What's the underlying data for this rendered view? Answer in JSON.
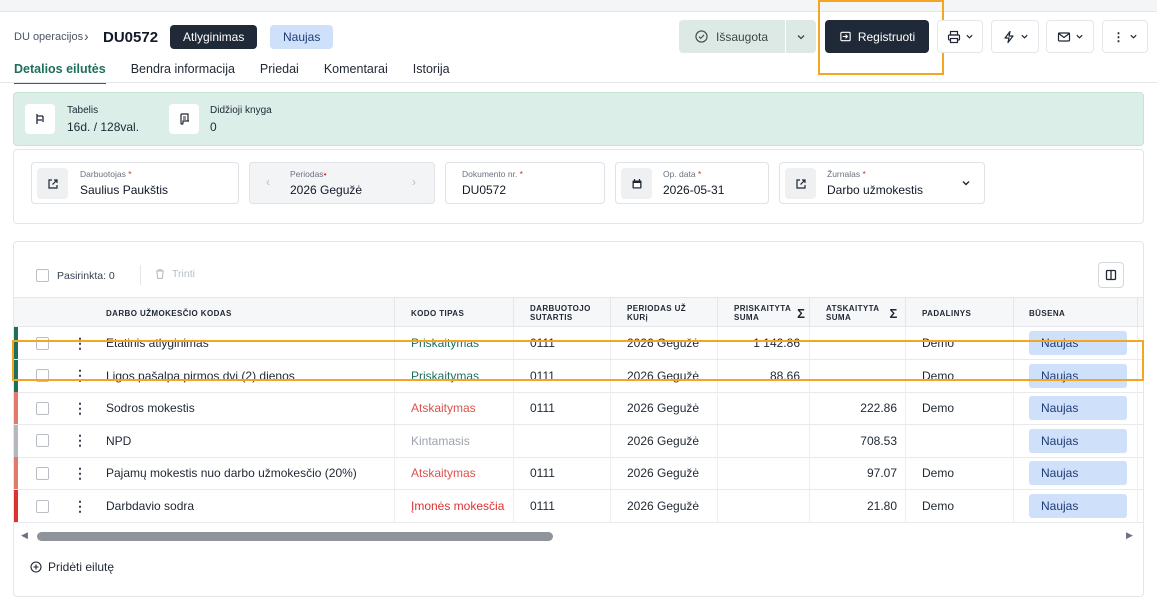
{
  "header": {
    "breadcrumb": "DU operacijos",
    "doc_id": "DU0572",
    "type_badge": "Atlyginimas",
    "status_badge": "Naujas",
    "saved_label": "Išsaugota",
    "register_label": "Registruoti"
  },
  "tabs": [
    "Detalios eilutės",
    "Bendra informacija",
    "Priedai",
    "Komentarai",
    "Istorija"
  ],
  "summary": {
    "tabelis_label": "Tabelis",
    "tabelis_value": "16d. / 128val.",
    "ledger_label": "Didžioji knyga",
    "ledger_value": "0"
  },
  "form": {
    "employee_label": "Darbuotojas",
    "employee_value": "Saulius Paukštis",
    "period_label": "Periodas",
    "period_value": "2026 Gegužė",
    "docnr_label": "Dokumento nr.",
    "docnr_value": "DU0572",
    "opdate_label": "Op. data",
    "opdate_value": "2026-05-31",
    "journal_label": "Žurnalas",
    "journal_value": "Darbo užmokestis"
  },
  "toolbar": {
    "selected": "Pasirinkta: 0",
    "delete": "Trinti"
  },
  "table": {
    "headers": {
      "code": "DARBO UŽMOKESČIO KODAS",
      "code_type": "KODO TIPAS",
      "contract_1": "DARBUOTOJO",
      "contract_2": "SUTARTIS",
      "period_1": "PERIODAS UŽ",
      "period_2": "KURį",
      "accrued_1": "PRISKAITYTA",
      "accrued_2": "SUMA",
      "deducted_1": "ATSKAITYTA",
      "deducted_2": "SUMA",
      "unit": "PADALINYS",
      "status": "BŪSENA"
    },
    "rows": [
      {
        "code": "Etatinis atlyginimas",
        "type": "Priskaitymas",
        "contract": "0111",
        "period": "2026 Gegužė",
        "accrued": "1 142.86",
        "deducted": "",
        "unit": "Demo",
        "status": "Naujas"
      },
      {
        "code": "Ligos pašalpa pirmos dvi (2) dienos",
        "type": "Priskaitymas",
        "contract": "0111",
        "period": "2026 Gegužė",
        "accrued": "88.66",
        "deducted": "",
        "unit": "Demo",
        "status": "Naujas"
      },
      {
        "code": "Sodros mokestis",
        "type": "Atskaitymas",
        "contract": "0111",
        "period": "2026 Gegužė",
        "accrued": "",
        "deducted": "222.86",
        "unit": "Demo",
        "status": "Naujas"
      },
      {
        "code": "NPD",
        "type": "Kintamasis",
        "contract": "",
        "period": "2026 Gegužė",
        "accrued": "",
        "deducted": "708.53",
        "unit": "",
        "status": "Naujas"
      },
      {
        "code": "Pajamų mokestis nuo darbo užmokesčio (20%)",
        "type": "Atskaitymas",
        "contract": "0111",
        "period": "2026 Gegužė",
        "accrued": "",
        "deducted": "97.07",
        "unit": "Demo",
        "status": "Naujas"
      },
      {
        "code": "Darbdavio sodra",
        "type": "Įmonės mokesčia",
        "contract": "0111",
        "period": "2026 Gegužė",
        "accrued": "",
        "deducted": "21.80",
        "unit": "Demo",
        "status": "Naujas"
      }
    ],
    "add_row": "Pridėti eilutę"
  },
  "colors": {
    "accent": "#1e6f5c",
    "priskaitymas": "#1e6f5c",
    "atskaitymas": "#d9534f",
    "kintamasis": "#9ca3af",
    "imones": "#e03131",
    "highlight": "#f5a524"
  },
  "icons": [
    "chevron-right-icon",
    "check-circle-icon",
    "chevron-down-icon",
    "register-icon",
    "printer-icon",
    "bolt-icon",
    "mail-icon",
    "kebab-icon",
    "timesheet-icon",
    "ledger-icon",
    "external-link-icon",
    "calendar-icon",
    "trash-icon",
    "columns-icon",
    "plus-circle-icon"
  ]
}
